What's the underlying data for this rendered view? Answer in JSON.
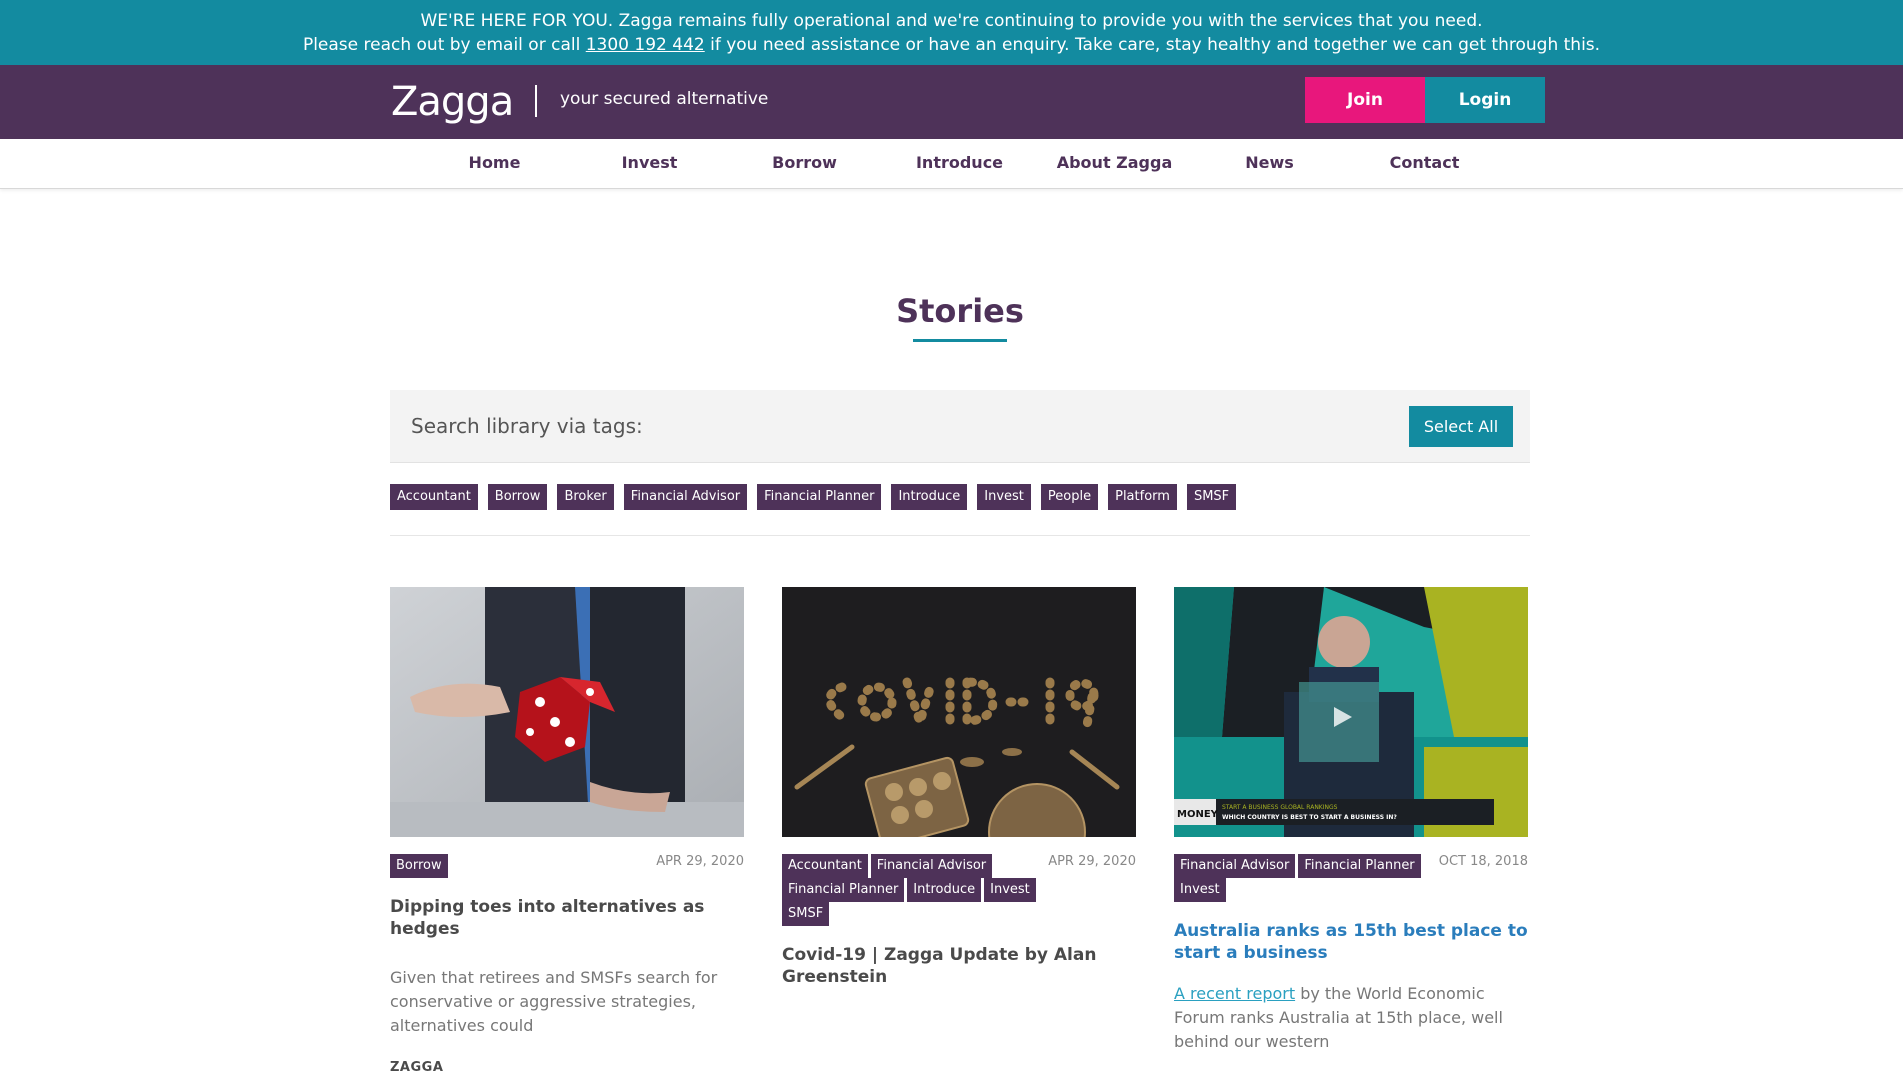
{
  "banner": {
    "line1": "WE'RE HERE FOR YOU. Zagga remains fully operational and we're continuing to provide you with the services that you need.",
    "line2_before": "Please reach out by email or call ",
    "phone": "1300 192 442",
    "line2_after": " if you need assistance or have an enquiry. Take care, stay healthy and together we can get through this.",
    "color": "#138ba0"
  },
  "header": {
    "logo": "Zagga",
    "tagline": "your secured alternative",
    "join_label": "Join",
    "login_label": "Login",
    "brand_color": "#4e3259",
    "join_color": "#e8177c"
  },
  "nav": {
    "items": [
      "Home",
      "Invest",
      "Borrow",
      "Introduce",
      "About Zagga",
      "News",
      "Contact"
    ]
  },
  "page": {
    "title": "Stories"
  },
  "search": {
    "label": "Search library via tags:",
    "select_all_label": "Select All",
    "tags": [
      "Accountant",
      "Borrow",
      "Broker",
      "Financial Advisor",
      "Financial Planner",
      "Introduce",
      "Invest",
      "People",
      "Platform",
      "SMSF"
    ]
  },
  "stories": [
    {
      "tags": [
        "Borrow"
      ],
      "date": "APR 29, 2020",
      "title": "Dipping toes into alternatives as hedges",
      "excerpt": "Given that retirees and SMSFs search for conservative or aggressive strategies, alternatives could",
      "author": "ZAGGA",
      "image": "hand-throwing-dice"
    },
    {
      "tags": [
        "Accountant",
        "Financial Advisor",
        "Financial Planner",
        "Introduce",
        "Invest",
        "SMSF"
      ],
      "date": "APR 29, 2020",
      "title": "Covid-19 | Zagga Update by Alan Greenstein",
      "image": "covid-19-pills"
    },
    {
      "tags": [
        "Financial Advisor",
        "Financial Planner",
        "Invest"
      ],
      "date": "OCT 18, 2018",
      "title": "Australia ranks as 15th best place to start a business",
      "excerpt_link": "A recent report",
      "excerpt_rest": " by the World Economic Forum ranks Australia at 15th place, well behind our western",
      "image": "video-interview-thumbnail",
      "video_caption_top": "START A BUSINESS   GLOBAL RANKINGS",
      "video_caption_bottom": "WHICH COUNTRY IS BEST TO START A BUSINESS IN?",
      "video_logo": "MONEY"
    }
  ]
}
